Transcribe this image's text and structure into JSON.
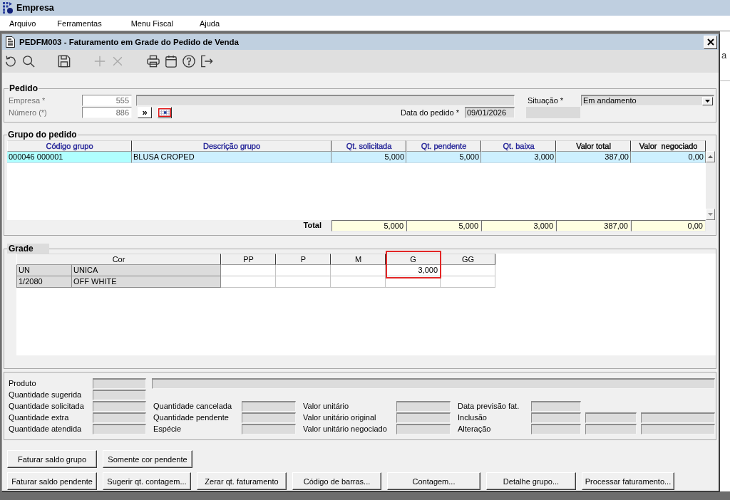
{
  "app_bar": {
    "title": "Empresa"
  },
  "menu": [
    "Arquivo",
    "Ferramentas",
    "Menu Fiscal",
    "Ajuda"
  ],
  "window": {
    "title": "PEDFM003 - Faturamento em Grade do Pedido de Venda"
  },
  "toolbar": [
    [
      {
        "kind": "undo",
        "disabled": false
      },
      {
        "kind": "search",
        "disabled": false
      }
    ],
    [
      {
        "kind": "save",
        "disabled": false
      }
    ],
    [
      {
        "kind": "add",
        "disabled": true
      },
      {
        "kind": "remove",
        "disabled": true
      }
    ],
    [
      {
        "kind": "print",
        "disabled": false
      },
      {
        "kind": "calendar",
        "disabled": false
      },
      {
        "kind": "help",
        "disabled": false
      },
      {
        "kind": "exit",
        "disabled": false
      }
    ]
  ],
  "pedido": {
    "title": "Pedido",
    "empresa": {
      "label": "Empresa *",
      "value": "555",
      "disabled": true
    },
    "numero": {
      "label": "Número (*)",
      "value": "886",
      "disabled": true
    },
    "next_button": "»",
    "data_pedido": {
      "label": "Data do pedido *",
      "value": "09/01/2026"
    },
    "situacao": {
      "label": "Situação *",
      "value": "Em andamento"
    }
  },
  "grupo": {
    "title": "Grupo do pedido",
    "columns": [
      {
        "label": "Código grupo",
        "color": "#1e1e96"
      },
      {
        "label": "Descrição grupo",
        "color": "#1e1e96"
      },
      {
        "label": "Qt. solicitada",
        "color": "#1e1e96"
      },
      {
        "label": "Qt. pendente",
        "color": "#1e1e96"
      },
      {
        "label": "Qt. baixa",
        "color": "#1e1e96"
      },
      {
        "label": "Valor total",
        "color": "#000000"
      },
      {
        "label": "Valor  negociado",
        "color": "#000000"
      }
    ],
    "rows": [
      {
        "cells": [
          "000046 000001",
          "BLUSA CROPED",
          "5,000",
          "5,000",
          "3,000",
          "387,00",
          "0,00"
        ],
        "selected": true
      }
    ],
    "total": {
      "label": "Total",
      "values": [
        "5,000",
        "5,000",
        "3,000",
        "387,00",
        "0,00"
      ]
    }
  },
  "grade": {
    "title": "Grade",
    "cor_header": "Cor",
    "columns": [
      {
        "label": "PP",
        "highlighted": false
      },
      {
        "label": "P",
        "highlighted": false
      },
      {
        "label": "M",
        "highlighted": false
      },
      {
        "label": "G",
        "highlighted": true
      },
      {
        "label": "GG",
        "highlighted": false
      }
    ],
    "rows": [
      {
        "code": "UN",
        "name": "UNICA",
        "cells": [
          {
            "kind": "empty"
          },
          {
            "kind": "empty"
          },
          {
            "kind": "empty"
          },
          {
            "kind": "filled",
            "value": "3,000"
          },
          {
            "kind": "empty"
          }
        ]
      },
      {
        "code": "1/2080",
        "name": "OFF WHITE",
        "cells": [
          {
            "kind": "empty"
          },
          {
            "kind": "empty"
          },
          {
            "kind": "empty"
          },
          {
            "kind": "empty"
          },
          {
            "kind": "empty"
          }
        ]
      }
    ]
  },
  "details": {
    "produto": "Produto",
    "sugerida": "Quantidade sugerida",
    "rows": [
      [
        {
          "label": "Quantidade solicitada",
          "kind": "single"
        },
        {
          "label": "Quantidade cancelada",
          "kind": "single"
        },
        {
          "label": "Valor unitário",
          "kind": "single"
        },
        {
          "label": "Data previsão fat.",
          "kind": "single"
        }
      ],
      [
        {
          "label": "Quantidade extra",
          "kind": "single"
        },
        {
          "label": "Quantidade pendente",
          "kind": "single"
        },
        {
          "label": "Valor unitário original",
          "kind": "single"
        },
        {
          "label": "Inclusão",
          "kind": "triple"
        }
      ],
      [
        {
          "label": "Quantidade atendida",
          "kind": "single"
        },
        {
          "label": "Espécie",
          "kind": "single"
        },
        {
          "label": "Valor unitário negociado",
          "kind": "single"
        },
        {
          "label": "Alteração",
          "kind": "triple"
        }
      ]
    ]
  },
  "buttons": [
    [
      "Faturar saldo grupo",
      "Somente cor pendente"
    ],
    [
      "Faturar saldo pendente",
      "Sugerir qt. contagem...",
      "Zerar qt. faturamento",
      "Código de barras...",
      "Contagem...",
      "Detalhe grupo...",
      "Processar faturamento..."
    ]
  ],
  "background_window": {
    "text": "a"
  }
}
